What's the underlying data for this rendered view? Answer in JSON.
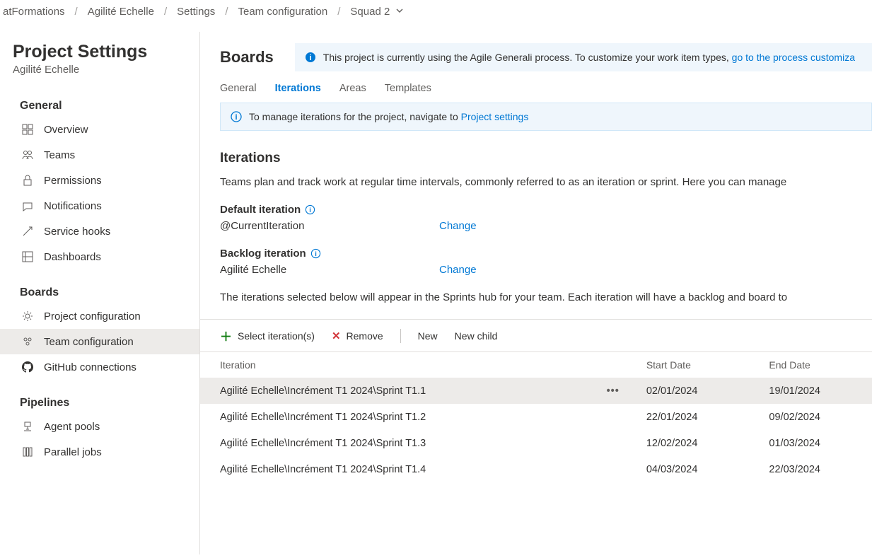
{
  "breadcrumb": {
    "items": [
      "atFormations",
      "Agilité Echelle",
      "Settings",
      "Team configuration",
      "Squad 2"
    ]
  },
  "sidebar": {
    "title": "Project Settings",
    "subtitle": "Agilité Echelle",
    "groups": [
      {
        "header": "General",
        "items": [
          {
            "label": "Overview",
            "icon": "overview"
          },
          {
            "label": "Teams",
            "icon": "teams"
          },
          {
            "label": "Permissions",
            "icon": "permissions"
          },
          {
            "label": "Notifications",
            "icon": "notifications"
          },
          {
            "label": "Service hooks",
            "icon": "hooks"
          },
          {
            "label": "Dashboards",
            "icon": "dashboards"
          }
        ]
      },
      {
        "header": "Boards",
        "items": [
          {
            "label": "Project configuration",
            "icon": "projectconfig"
          },
          {
            "label": "Team configuration",
            "icon": "teamconfig",
            "selected": true
          },
          {
            "label": "GitHub connections",
            "icon": "github"
          }
        ]
      },
      {
        "header": "Pipelines",
        "items": [
          {
            "label": "Agent pools",
            "icon": "agentpools"
          },
          {
            "label": "Parallel jobs",
            "icon": "paralleljobs"
          }
        ]
      }
    ]
  },
  "content": {
    "title": "Boards",
    "banner_text": "This project is currently using the Agile Generali process. To customize your work item types, ",
    "banner_link": "go to the process customiza",
    "tabs": [
      "General",
      "Iterations",
      "Areas",
      "Templates"
    ],
    "active_tab": "Iterations",
    "sub_banner_text": "To manage iterations for the project, navigate to ",
    "sub_banner_link": "Project settings",
    "section_header": "Iterations",
    "section_desc": "Teams plan and track work at regular time intervals, commonly referred to as an iteration or sprint. Here you can manage",
    "default_iter_label": "Default iteration",
    "default_iter_value": "@CurrentIteration",
    "change_label": "Change",
    "backlog_iter_label": "Backlog iteration",
    "backlog_iter_value": "Agilité Echelle",
    "selected_desc": "The iterations selected below will appear in the Sprints hub for your team. Each iteration will have a backlog and board to",
    "toolbar": {
      "select": "Select iteration(s)",
      "remove": "Remove",
      "new": "New",
      "new_child": "New child"
    },
    "table": {
      "headers": {
        "iteration": "Iteration",
        "start": "Start Date",
        "end": "End Date"
      },
      "rows": [
        {
          "iteration": "Agilité Echelle\\Incrément T1 2024\\Sprint T1.1",
          "start": "02/01/2024",
          "end": "19/01/2024",
          "selected": true
        },
        {
          "iteration": "Agilité Echelle\\Incrément T1 2024\\Sprint T1.2",
          "start": "22/01/2024",
          "end": "09/02/2024"
        },
        {
          "iteration": "Agilité Echelle\\Incrément T1 2024\\Sprint T1.3",
          "start": "12/02/2024",
          "end": "01/03/2024"
        },
        {
          "iteration": "Agilité Echelle\\Incrément T1 2024\\Sprint T1.4",
          "start": "04/03/2024",
          "end": "22/03/2024"
        }
      ]
    }
  }
}
